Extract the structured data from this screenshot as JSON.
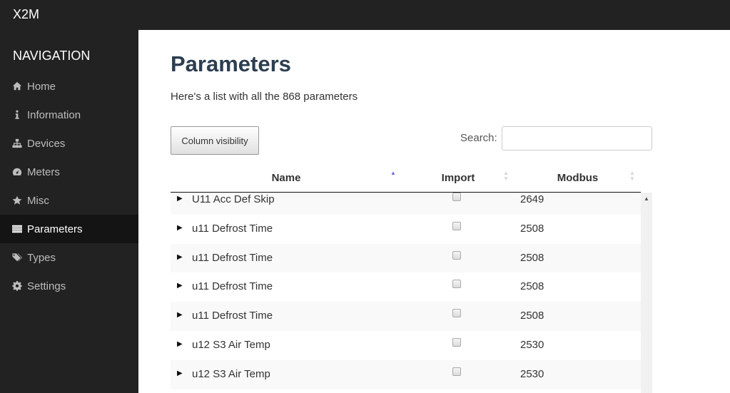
{
  "app": {
    "brand": "X2M"
  },
  "sidebar": {
    "heading": "NAVIGATION",
    "items": [
      {
        "label": "Home",
        "icon": "home-icon",
        "active": false
      },
      {
        "label": "Information",
        "icon": "info-icon",
        "active": false
      },
      {
        "label": "Devices",
        "icon": "sitemap-icon",
        "active": false
      },
      {
        "label": "Meters",
        "icon": "dashboard-icon",
        "active": false
      },
      {
        "label": "Misc",
        "icon": "star-icon",
        "active": false
      },
      {
        "label": "Parameters",
        "icon": "list-icon",
        "active": true
      },
      {
        "label": "Types",
        "icon": "tags-icon",
        "active": false
      },
      {
        "label": "Settings",
        "icon": "gear-icon",
        "active": false
      }
    ]
  },
  "main": {
    "title": "Parameters",
    "subtitle": "Here's a list with all the 868 parameters",
    "column_visibility_label": "Column visibility",
    "search": {
      "label": "Search:",
      "value": "",
      "placeholder": ""
    },
    "table": {
      "columns": [
        {
          "label": "Name",
          "sort": "ascending"
        },
        {
          "label": "Import",
          "sort": "none"
        },
        {
          "label": "Modbus",
          "sort": "none"
        }
      ],
      "rows": [
        {
          "name": "U11 Acc Def Skip",
          "import": false,
          "modbus": "2649"
        },
        {
          "name": "u11 Defrost Time",
          "import": false,
          "modbus": "2508"
        },
        {
          "name": "u11 Defrost Time",
          "import": false,
          "modbus": "2508"
        },
        {
          "name": "u11 Defrost Time",
          "import": false,
          "modbus": "2508"
        },
        {
          "name": "u11 Defrost Time",
          "import": false,
          "modbus": "2508"
        },
        {
          "name": "u12 S3 Air Temp",
          "import": false,
          "modbus": "2530"
        },
        {
          "name": "u12 S3 Air Temp",
          "import": false,
          "modbus": "2530"
        }
      ]
    }
  },
  "colors": {
    "sidebar_bg": "#222222",
    "active_item_bg": "#141414",
    "title_color": "#2c3e50",
    "sort_active": "#6b6bd6"
  }
}
